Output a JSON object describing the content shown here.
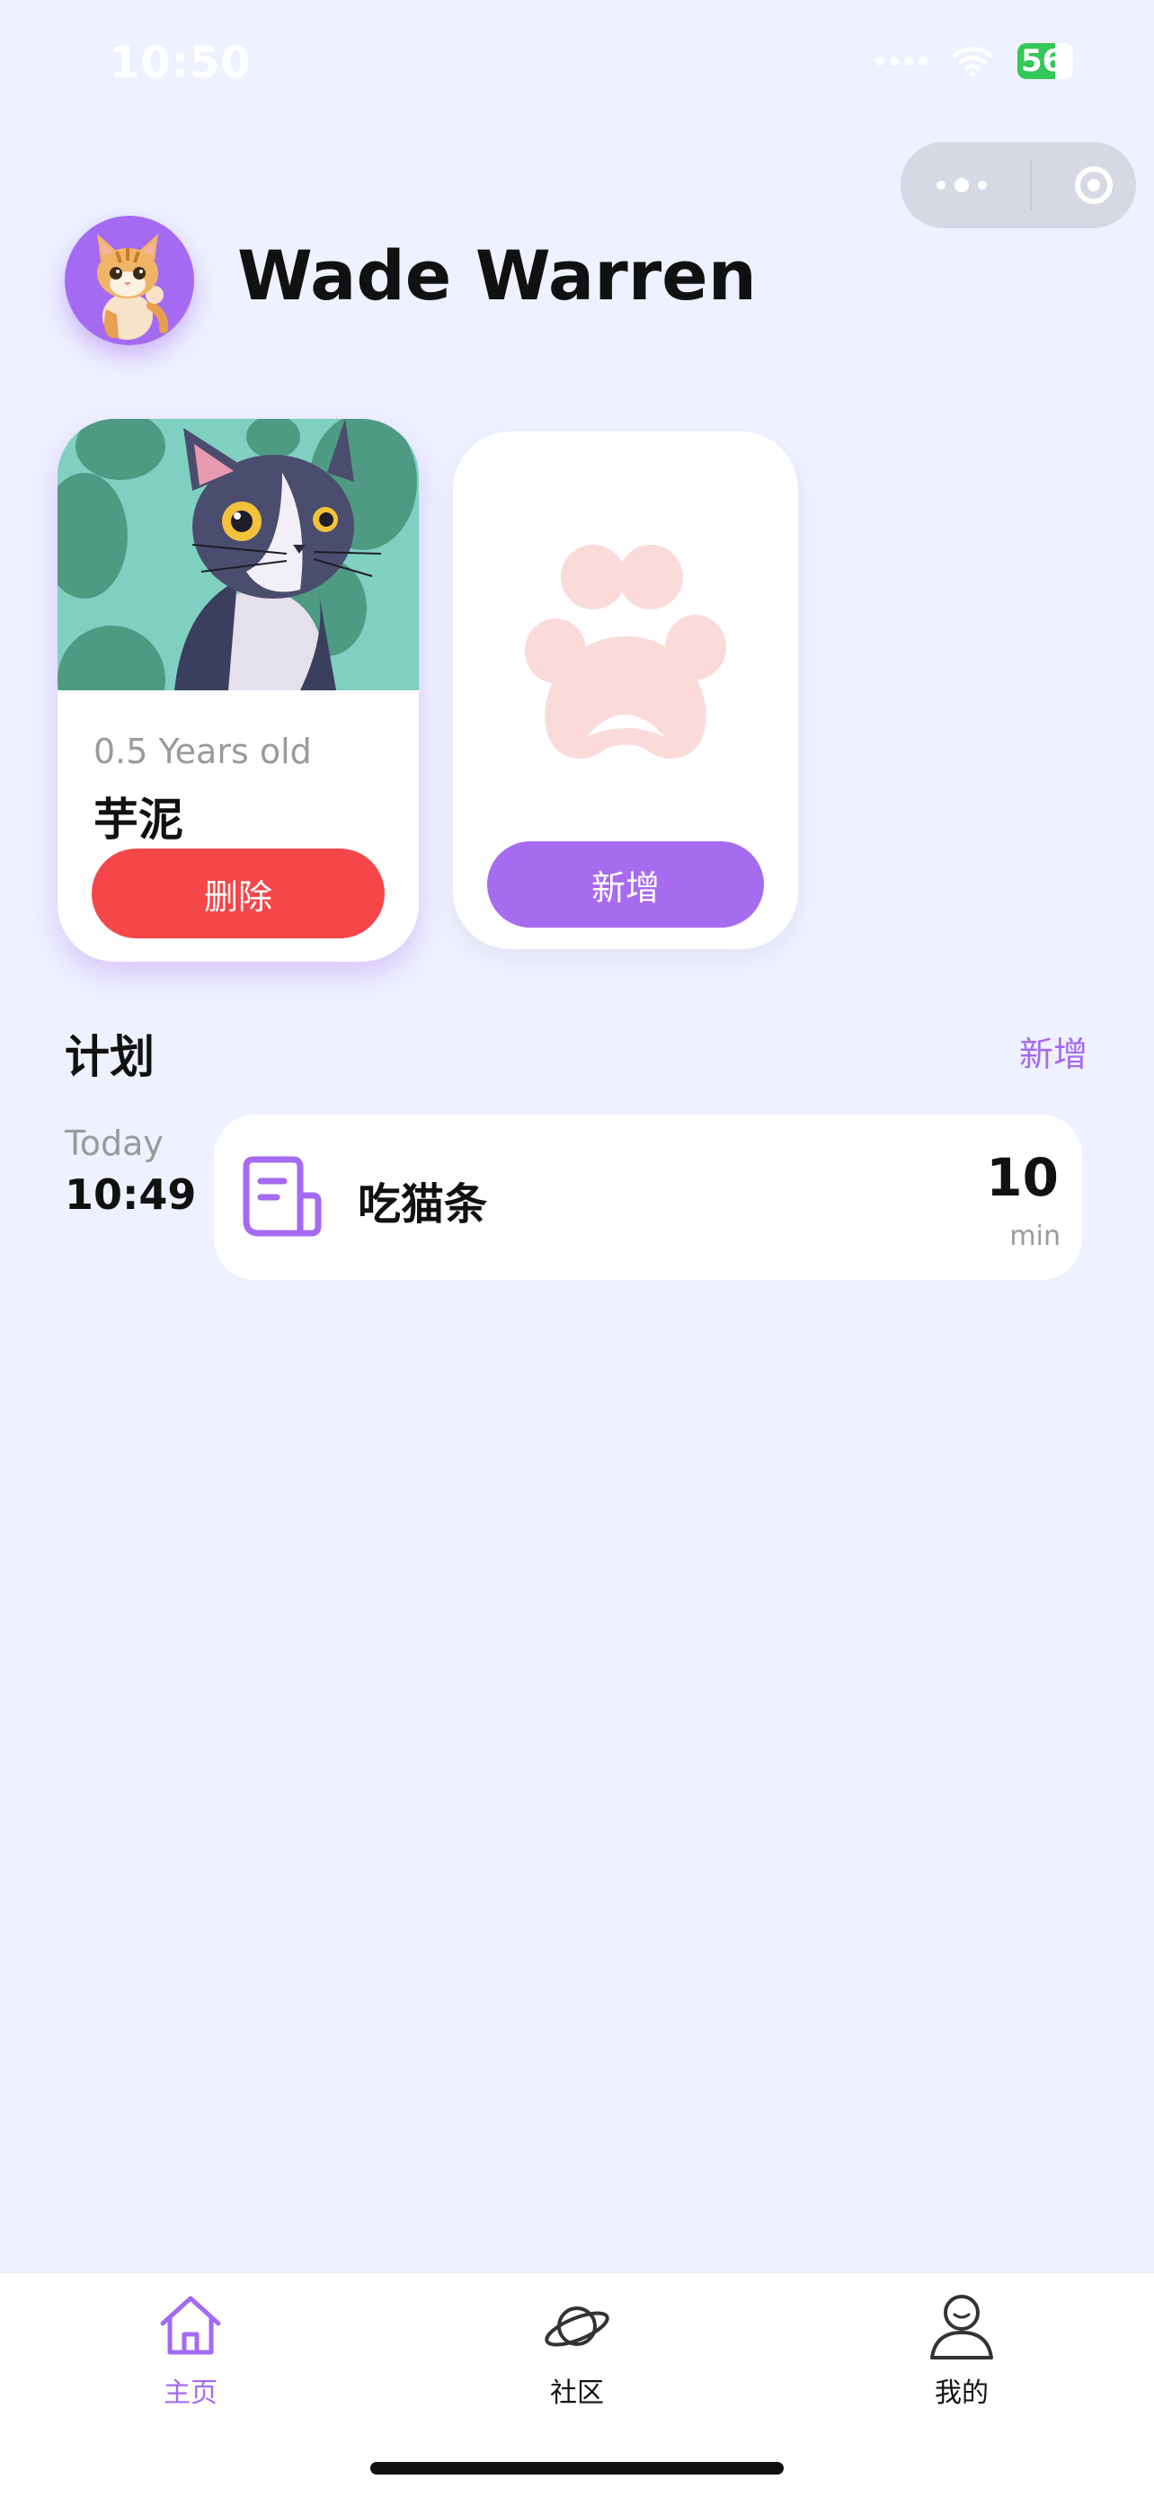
{
  "status_bar": {
    "time": "10:50",
    "battery": "56"
  },
  "profile": {
    "username": "Wade Warren"
  },
  "pets": [
    {
      "age": "0.5 Years old",
      "name": "芋泥",
      "delete_label": "删除"
    }
  ],
  "add_pet": {
    "label": "新增"
  },
  "plan": {
    "title": "计划",
    "add_label": "新增",
    "items": [
      {
        "day": "Today",
        "time": "10:49",
        "task": "吃猫条",
        "duration": "10",
        "unit": "min"
      }
    ]
  },
  "tabbar": {
    "items": [
      {
        "label": "主页",
        "icon": "home-icon",
        "active": true
      },
      {
        "label": "社区",
        "icon": "planet-icon",
        "active": false
      },
      {
        "label": "我的",
        "icon": "profile-icon",
        "active": false
      }
    ]
  },
  "colors": {
    "background": "#EEF1FF",
    "accent": "#A46AF2",
    "danger": "#F5464A",
    "paw": "#FADBDA"
  }
}
